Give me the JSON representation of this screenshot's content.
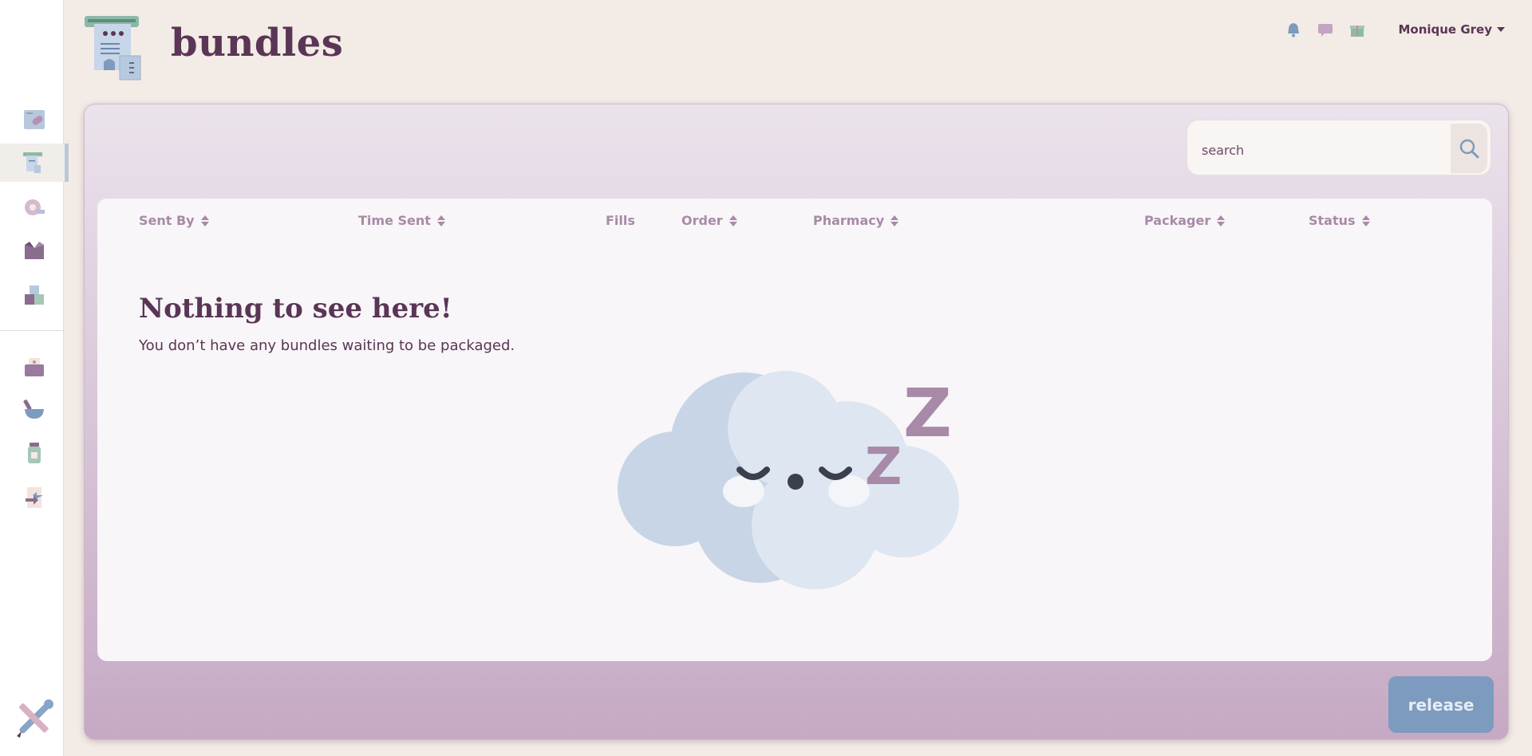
{
  "header": {
    "title": "bundles"
  },
  "user": {
    "name": "Monique Grey"
  },
  "search": {
    "placeholder": "search"
  },
  "table": {
    "columns": [
      {
        "label": "Sent By",
        "sortable": true
      },
      {
        "label": "Time Sent",
        "sortable": true
      },
      {
        "label": "Fills",
        "sortable": false
      },
      {
        "label": "Order",
        "sortable": true
      },
      {
        "label": "Pharmacy",
        "sortable": true
      },
      {
        "label": "Packager",
        "sortable": true
      },
      {
        "label": "Status",
        "sortable": true
      }
    ]
  },
  "empty_state": {
    "title": "Nothing to see here!",
    "message": "You don’t have any bundles waiting to be packaged.",
    "z_big": "Z",
    "z_small": "Z"
  },
  "actions": {
    "release_label": "release"
  },
  "colors": {
    "brand": "#5a3555",
    "accent": "#7d9bbe",
    "muted": "#a88aa8"
  }
}
